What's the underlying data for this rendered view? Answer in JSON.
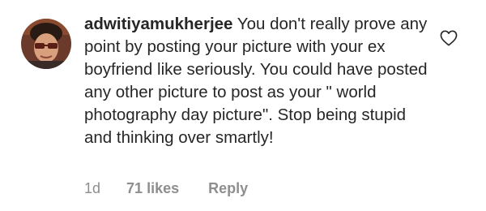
{
  "comment": {
    "username": "adwitiyamukherjee",
    "text": "You don't really prove any point by posting your picture with your ex boyfriend like seriously. You could have posted any other picture to post as your \" world photography day picture\". Stop being stupid and thinking over smartly!",
    "avatar_icon": "user-avatar",
    "like_icon": "heart-outline-icon"
  },
  "meta": {
    "time": "1d",
    "likes": "71 likes",
    "reply": "Reply"
  },
  "colors": {
    "text": "#262626",
    "secondary": "#8e8e8e",
    "background": "#ffffff"
  }
}
